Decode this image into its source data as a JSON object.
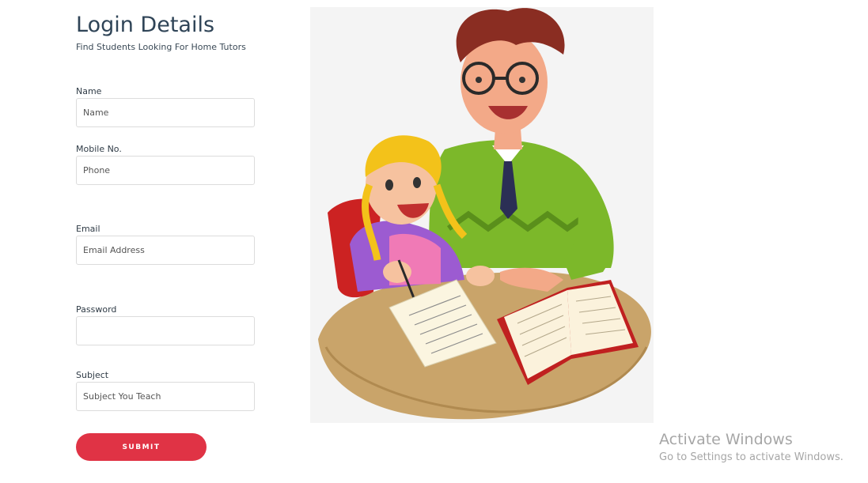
{
  "header": {
    "title": "Login Details",
    "subtitle": "Find Students Looking For Home Tutors"
  },
  "form": {
    "name": {
      "label": "Name",
      "placeholder": "Name",
      "value": ""
    },
    "mobile": {
      "label": "Mobile No.",
      "placeholder": "Phone",
      "value": ""
    },
    "email": {
      "label": "Email",
      "placeholder": "Email Address",
      "value": ""
    },
    "password": {
      "label": "Password",
      "placeholder": "",
      "value": ""
    },
    "subject": {
      "label": "Subject",
      "placeholder": "Subject You Teach",
      "value": ""
    },
    "submit_label": "SUBMIT"
  },
  "illustration": {
    "icon": "tutor-and-student-illustration"
  },
  "watermark": {
    "title": "Activate Windows",
    "subtitle": "Go to Settings to activate Windows."
  },
  "colors": {
    "accent": "#e03345",
    "title": "#2f4457",
    "input_border": "#dcdcdc",
    "watermark": "#a6a6a6"
  }
}
